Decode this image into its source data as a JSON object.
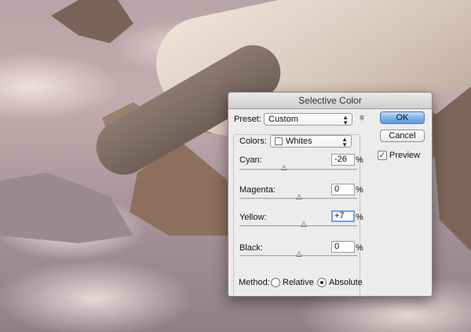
{
  "dialog": {
    "title": "Selective Color",
    "preset_label": "Preset:",
    "preset_value": "Custom",
    "colors_label": "Colors:",
    "colors_value": "Whites",
    "ok_label": "OK",
    "cancel_label": "Cancel",
    "preview_label": "Preview",
    "preview_checked": true,
    "method_label": "Method:",
    "method_options": [
      "Relative",
      "Absolute"
    ],
    "method_selected": "Absolute",
    "percent_symbol": "%",
    "sliders": [
      {
        "label": "Cyan:",
        "value": "-26"
      },
      {
        "label": "Magenta:",
        "value": "0"
      },
      {
        "label": "Yellow:",
        "value": "+7"
      },
      {
        "label": "Black:",
        "value": "0"
      }
    ]
  },
  "colors": {
    "accent": "#5e9ce2",
    "focus_ring": "#6fa3e0"
  },
  "icons": {
    "preset_menu": "list-options-icon",
    "check": "check-icon"
  }
}
